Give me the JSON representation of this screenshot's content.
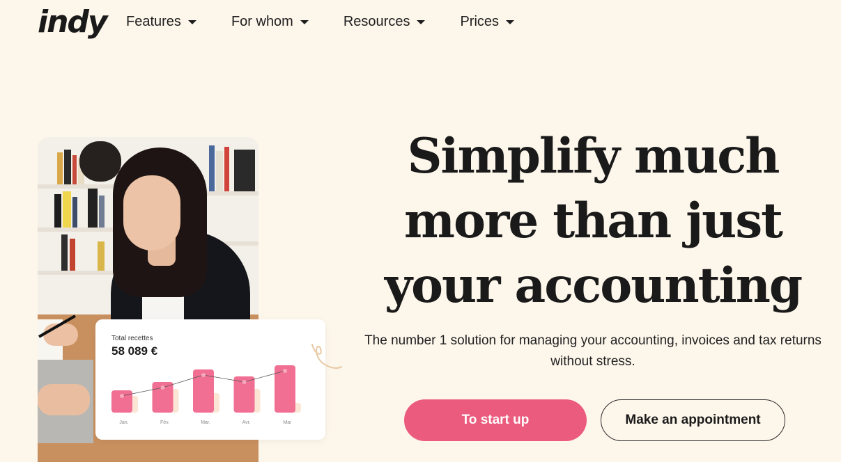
{
  "header": {
    "logo_text": "indy",
    "nav": [
      {
        "label": "Features"
      },
      {
        "label": "For whom"
      },
      {
        "label": "Resources"
      },
      {
        "label": "Prices"
      }
    ]
  },
  "hero": {
    "title": "Simplify much more than just your accounting",
    "subtitle": "The number 1 solution for managing your accounting, invoices and tax returns without stress.",
    "primary_cta": "To start up",
    "secondary_cta": "Make an appointment"
  },
  "stats_card": {
    "label": "Total recettes",
    "value": "58 089 €"
  },
  "chart_data": {
    "type": "bar",
    "categories": [
      "Jan.",
      "Fév.",
      "Mar.",
      "Avr.",
      "Mai"
    ],
    "series": [
      {
        "values": [
          32,
          44,
          62,
          52,
          68
        ],
        "color": "#f06f93"
      },
      {
        "values": [
          24,
          34,
          28,
          34,
          14
        ],
        "color": "#fbe6d5"
      }
    ],
    "line": [
      32,
      44,
      62,
      52,
      68
    ],
    "ylim": [
      0,
      80
    ],
    "grid": false
  },
  "colors": {
    "background": "#fdf6eb",
    "accent": "#eb5b7d"
  }
}
